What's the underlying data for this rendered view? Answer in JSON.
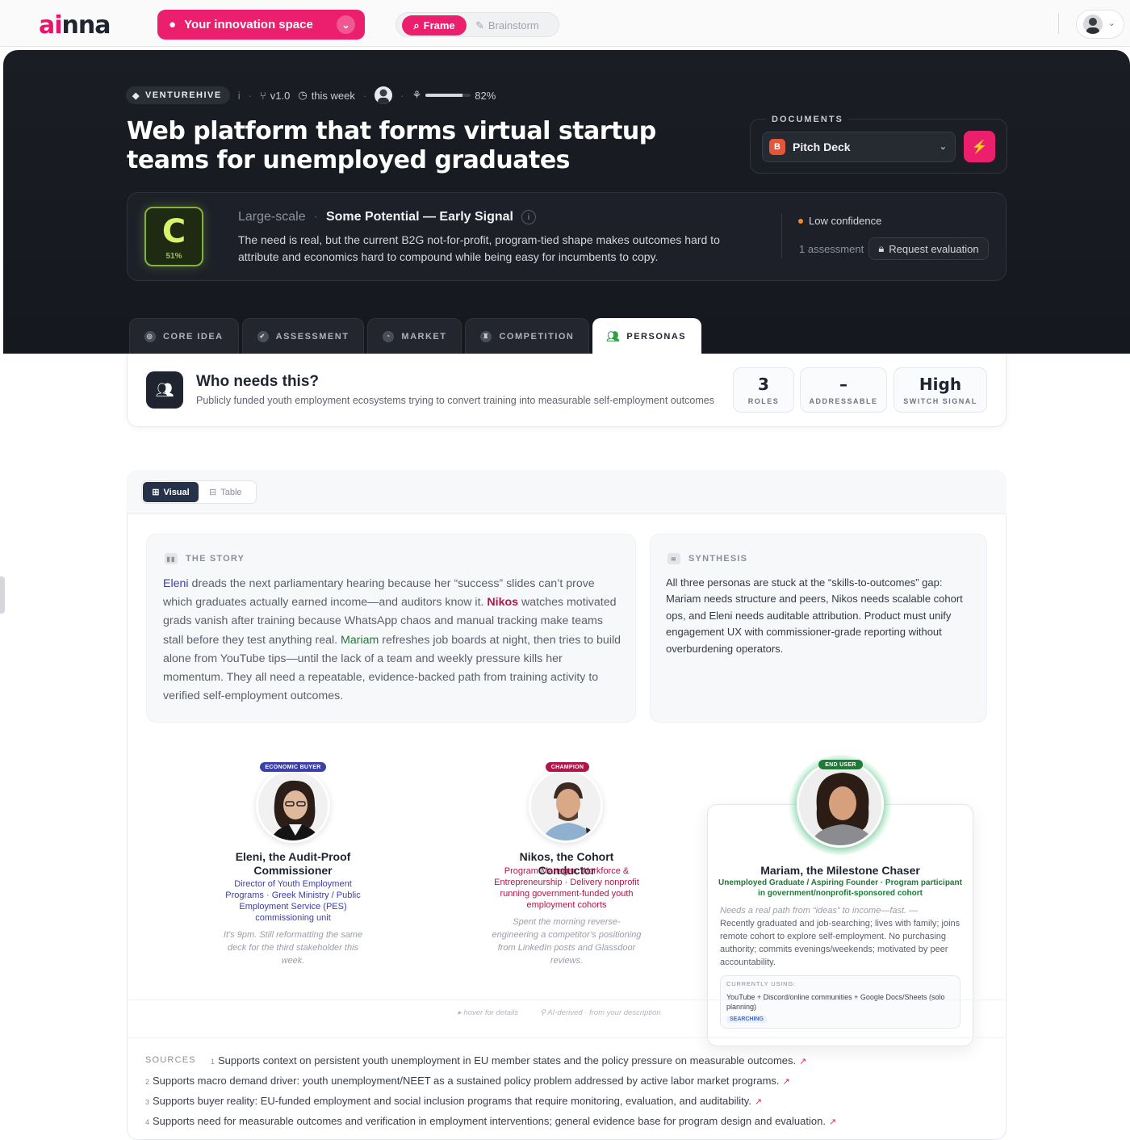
{
  "topbar": {
    "logo_accent": "ai",
    "logo_rest": "nna",
    "space_label": "Your innovation space",
    "modes": {
      "frame": "Frame",
      "brainstorm": "Brainstorm"
    }
  },
  "project": {
    "badge": "VENTUREHIVE",
    "info": "i",
    "version": "v1.0",
    "updated": "this week",
    "progress_label": "82%",
    "progress_value": 0.82,
    "title": "Web platform that forms virtual startup teams for unemployed graduates"
  },
  "documents": {
    "label": "DOCUMENTS",
    "selected": "Pitch Deck",
    "file_icon_letter": "B"
  },
  "score": {
    "grade": "C",
    "grade_pct": "51%",
    "scale": "Large-scale",
    "potential": "Some Potential — Early Signal",
    "description": "The need is real, but the current B2G not-for-profit, program-tied shape makes outcomes hard to attribute and economics hard to compound while being easy for incumbents to copy.",
    "confidence": "Low confidence",
    "assessments": "1 assessment",
    "request_label": "Request evaluation"
  },
  "tabs": [
    {
      "label": "CORE IDEA",
      "active": false
    },
    {
      "label": "ASSESSMENT",
      "active": false
    },
    {
      "label": "MARKET",
      "active": false
    },
    {
      "label": "COMPETITION",
      "active": false
    },
    {
      "label": "PERSONAS",
      "active": true
    }
  ],
  "who": {
    "title": "Who needs this?",
    "subtitle": "Publicly funded youth employment ecosystems trying to convert training into measurable self-employment outcomes",
    "stats": [
      {
        "value": "3",
        "label": "ROLES"
      },
      {
        "value": "–",
        "label": "ADDRESSABLE"
      },
      {
        "value": "High",
        "label": "SWITCH SIGNAL"
      }
    ]
  },
  "view_toggle": {
    "visual": "Visual",
    "table": "Table",
    "active": "Visual"
  },
  "story": {
    "label": "THE STORY",
    "parts": [
      {
        "t": "Eleni",
        "c": "n1"
      },
      {
        "t": " dreads the next parliamentary hearing because her “success” slides can’t prove which graduates actually earned income—and auditors know it. ",
        "c": ""
      },
      {
        "t": "Nikos",
        "c": "n2"
      },
      {
        "t": " watches motivated grads vanish after training because WhatsApp chaos and manual tracking make teams stall before they test anything real. ",
        "c": ""
      },
      {
        "t": "Mariam",
        "c": "n3"
      },
      {
        "t": " refreshes job boards at night, then tries to build alone from YouTube tips—until the lack of a team and weekly pressure kills her momentum. They all need a repeatable, evidence-backed path from training activity to verified self-employment outcomes.",
        "c": ""
      }
    ]
  },
  "synthesis": {
    "label": "SYNTHESIS",
    "text": "All three personas are stuck at the “skills-to-outcomes” gap: Mariam needs structure and peers, Nikos needs scalable cohort ops, and Eleni needs auditable attribution. Product must unify engagement UX with commissioner-grade reporting without overburdening operators."
  },
  "personas": [
    {
      "badge": "ECONOMIC BUYER",
      "badge_color": "#3b3fa8",
      "name": "Eleni, the Audit-Proof Commissioner",
      "role": "Director of Youth Employment Programs · Greek Ministry / Public Employment Service (PES) commissioning unit",
      "role_color": "#3b3fa8",
      "quote": "It’s 9pm. Still reformatting the same deck for the third stakeholder this week."
    },
    {
      "badge": "CHAMPION",
      "badge_color": "#b0164a",
      "name": "Nikos, the Cohort Conductor",
      "role": "Program Manager, Workforce & Entrepreneurship · Delivery nonprofit running government-funded youth employment cohorts",
      "role_color": "#b0164a",
      "quote": "Spent the morning reverse-engineering a competitor’s positioning from LinkedIn posts and Glassdoor reviews."
    },
    {
      "badge": "END USER",
      "badge_color": "#1d7a37",
      "name": "Mariam, the Milestone Chaser",
      "role": "Unemployed Graduate / Aspiring Founder · Program participant in government/nonprofit-sponsored cohort",
      "role_color": "#1d7a37",
      "quote": "Needs a real path from “ideas” to income—fast. —",
      "description": "Recently graduated and job-searching; lives with family; joins remote cohort to explore self-employment. No purchasing authority; commits evenings/weekends; motivated by peer accountability.",
      "using_label": "CURRENTLY USING:",
      "using_text": "YouTube + Discord/online communities + Google Docs/Sheets (solo planning)",
      "using_status": "SEARCHING"
    }
  ],
  "hints": {
    "hover": "hover for details",
    "ai": "AI-derived · from your description"
  },
  "sources": {
    "label": "SOURCES",
    "items": [
      {
        "num": "1",
        "text": "Supports context on persistent youth unemployment in EU member states and the policy pressure on measurable outcomes."
      },
      {
        "num": "2",
        "text": "Supports macro demand driver: youth unemployment/NEET as a sustained policy problem addressed by active labor market programs."
      },
      {
        "num": "3",
        "text": "Supports buyer reality: EU-funded employment and social inclusion programs that require monitoring, evaluation, and auditability."
      },
      {
        "num": "4",
        "text": "Supports need for measurable outcomes and verification in employment interventions; general evidence base for program design and evaluation."
      }
    ]
  },
  "colors": {
    "brand": "#ec1f6e",
    "grade": "#84b33b",
    "confidence_dot": "#f08a24"
  }
}
